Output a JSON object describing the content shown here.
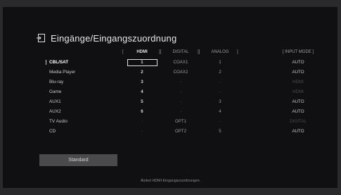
{
  "title": "Eingänge/Eingangszuordnung",
  "headers": {
    "hdmi": "HDMI",
    "digital": "DIGITAL",
    "analog": "ANALOG",
    "input_mode": "[ INPUT MODE ]",
    "bracket_left": "[",
    "bracket_mid1": "][",
    "bracket_mid2": "][",
    "bracket_right": "]"
  },
  "rows": [
    {
      "name": "CBL/SAT",
      "hdmi": "1",
      "digital": "COAX1",
      "analog": "1",
      "mode": "AUTO",
      "selected": true
    },
    {
      "name": "Media Player",
      "hdmi": "2",
      "digital": "COAX2",
      "analog": "2",
      "mode": "AUTO"
    },
    {
      "name": "Blu-ray",
      "hdmi": "3",
      "digital": "-",
      "analog": "-",
      "mode": "HDMI",
      "mode_dim": true
    },
    {
      "name": "Game",
      "hdmi": "4",
      "digital": "-",
      "analog": "-",
      "mode": "HDMI",
      "mode_dim": true
    },
    {
      "name": "AUX1",
      "hdmi": "5",
      "digital": "-",
      "analog": "3",
      "mode": "AUTO"
    },
    {
      "name": "AUX2",
      "hdmi": "6",
      "digital": "-",
      "analog": "4",
      "mode": "AUTO"
    },
    {
      "name": "TV Audio",
      "hdmi": "-",
      "digital": "OPT1",
      "analog": "-",
      "mode": "DIGITAL",
      "mode_dim": true
    },
    {
      "name": "CD",
      "hdmi": "-",
      "digital": "OPT2",
      "analog": "5",
      "mode": "AUTO"
    }
  ],
  "standard_button": "Standard",
  "footer": "Ändert HDMI-Eingangszuordnungen.",
  "icons": {
    "title": "input-assign-icon"
  },
  "colors": {
    "panel": "#101012",
    "outer": "#2a2a2c",
    "button": "#4a4a4c"
  }
}
